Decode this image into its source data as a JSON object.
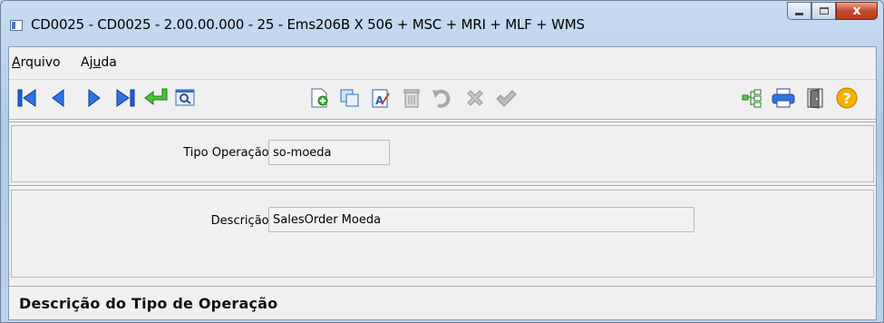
{
  "window": {
    "title": "CD0025 - CD0025 - 2.00.00.000 - 25 - Ems206B X 506 + MSC + MRI + MLF + WMS",
    "close_glyph": "x"
  },
  "menu": {
    "items": [
      {
        "label": "Arquivo",
        "mnemonic": "A",
        "rest": "rquivo"
      },
      {
        "label": "Ajuda",
        "pre": "Aj",
        "mnemonic": "u",
        "rest": "da"
      }
    ]
  },
  "toolbar": {
    "buttons": [
      {
        "name": "first-record",
        "icon": "first-icon",
        "color": "#1f5fd6"
      },
      {
        "name": "previous-record",
        "icon": "previous-icon",
        "color": "#1f5fd6"
      },
      {
        "name": "next-record",
        "icon": "next-icon",
        "color": "#1f5fd6"
      },
      {
        "name": "last-record",
        "icon": "last-icon",
        "color": "#1f5fd6"
      },
      {
        "name": "goto-record",
        "icon": "enter-arrow-icon",
        "color": "#3aa52a"
      },
      {
        "name": "search",
        "icon": "zoom-icon",
        "color": "#3a6fb5"
      },
      {
        "name": "new-record",
        "icon": "new-document-icon",
        "color": "#2e9e2a"
      },
      {
        "name": "copy-record",
        "icon": "copy-icon",
        "color": "#3a8fd6"
      },
      {
        "name": "edit-record",
        "icon": "edit-icon",
        "color": "#2d5ea8"
      },
      {
        "name": "delete-record",
        "icon": "trash-icon",
        "color": "#b0b0b0"
      },
      {
        "name": "undo",
        "icon": "undo-icon",
        "color": "#b0b0b0"
      },
      {
        "name": "cancel",
        "icon": "cancel-icon",
        "color": "#b0b0b0"
      },
      {
        "name": "confirm",
        "icon": "check-icon",
        "color": "#b0b0b0"
      },
      {
        "name": "tree",
        "icon": "tree-icon",
        "color": "#2f9a2a"
      },
      {
        "name": "print",
        "icon": "printer-icon",
        "color": "#1f5fd6"
      },
      {
        "name": "exit",
        "icon": "door-icon",
        "color": "#555555"
      },
      {
        "name": "help",
        "icon": "help-icon",
        "color": "#f0a000"
      }
    ]
  },
  "form": {
    "tipo_label": "Tipo Operação:",
    "tipo_value": "so-moeda",
    "descricao_label": "Descrição:",
    "descricao_value": "SalesOrder Moeda"
  },
  "status": {
    "text": "Descrição do Tipo de Operação"
  }
}
